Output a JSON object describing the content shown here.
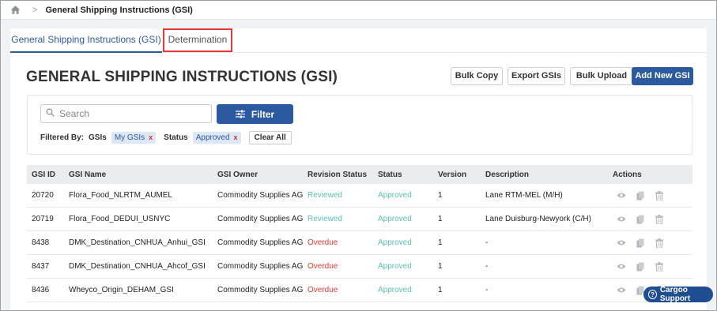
{
  "breadcrumb": {
    "current": "General Shipping Instructions (GSI)"
  },
  "tabs": [
    {
      "label": "General Shipping Instructions (GSI)"
    },
    {
      "label": "Determination"
    }
  ],
  "page": {
    "title": "GENERAL SHIPPING INSTRUCTIONS (GSI)"
  },
  "toolbar": {
    "bulk_copy": "Bulk Copy",
    "export": "Export GSIs",
    "bulk_upload": "Bulk Upload",
    "add_new": "Add New GSI"
  },
  "search": {
    "placeholder": "Search",
    "value": ""
  },
  "filter": {
    "button": "Filter",
    "filtered_by": "Filtered By:",
    "gsis_label": "GSIs",
    "gsis_value": "My GSIs",
    "status_label": "Status",
    "status_value": "Approved",
    "clear": "Clear All",
    "remove_glyph": "x"
  },
  "table": {
    "headers": [
      "GSI ID",
      "GSI Name",
      "GSI Owner",
      "Revision Status",
      "Status",
      "Version",
      "Description",
      "Actions"
    ],
    "rows": [
      {
        "id": "20720",
        "name": "Flora_Food_NLRTM_AUMEL",
        "owner": "Commodity Supplies AG",
        "revision": "Reviewed",
        "status": "Approved",
        "version": "1",
        "description": "Lane RTM-MEL (M/H)"
      },
      {
        "id": "20719",
        "name": "Flora_Food_DEDUI_USNYC",
        "owner": "Commodity Supplies AG",
        "revision": "Reviewed",
        "status": "Approved",
        "version": "1",
        "description": "Lane Duisburg-Newyork (C/H)"
      },
      {
        "id": "8438",
        "name": "DMK_Destination_CNHUA_Anhui_GSI",
        "owner": "Commodity Supplies AG",
        "revision": "Overdue",
        "status": "Approved",
        "version": "1",
        "description": "-"
      },
      {
        "id": "8437",
        "name": "DMK_Destination_CNHUA_Ahcof_GSI",
        "owner": "Commodity Supplies AG",
        "revision": "Overdue",
        "status": "Approved",
        "version": "1",
        "description": "-"
      },
      {
        "id": "8436",
        "name": "Wheyco_Origin_DEHAM_GSI",
        "owner": "Commodity Supplies AG",
        "revision": "Overdue",
        "status": "Approved",
        "version": "1",
        "description": "-"
      }
    ]
  },
  "support": {
    "label": "Cargoo Support"
  },
  "colors": {
    "primary": "#2c5aa0",
    "overdue": "#e53935",
    "reviewed": "#5bbfb0",
    "highlight": "#e53935"
  },
  "icons": [
    "home-icon",
    "chevron-right-icon",
    "search-icon",
    "sliders-icon",
    "eye-icon",
    "copy-icon",
    "trash-icon",
    "help-icon"
  ]
}
